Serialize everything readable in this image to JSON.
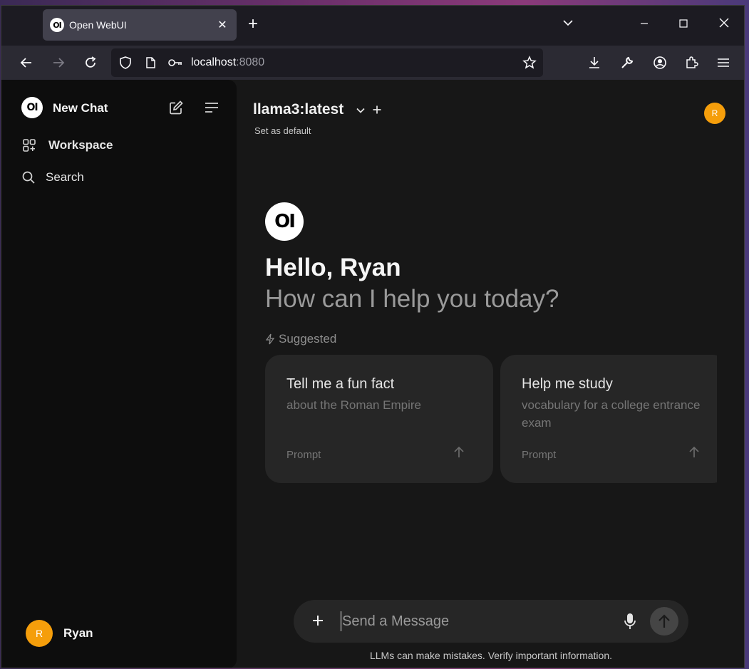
{
  "browser": {
    "tab_title": "Open WebUI",
    "tab_logo_text": "OI",
    "url_host": "localhost",
    "url_port": ":8080"
  },
  "sidebar": {
    "logo_text": "OI",
    "new_chat_label": "New Chat",
    "items": [
      {
        "label": "Workspace",
        "icon": "workspace-icon"
      },
      {
        "label": "Search",
        "icon": "search-icon"
      }
    ],
    "user": {
      "initial": "R",
      "name": "Ryan"
    }
  },
  "header": {
    "model_name": "llama3:latest",
    "set_default_label": "Set as default",
    "avatar_initial": "R"
  },
  "hero": {
    "logo_text": "OI",
    "greeting": "Hello, Ryan",
    "subtitle": "How can I help you today?",
    "suggested_label": "Suggested"
  },
  "suggestions": [
    {
      "title": "Tell me a fun fact",
      "subtitle": "about the Roman Empire",
      "prompt_label": "Prompt"
    },
    {
      "title": "Help me study",
      "subtitle": "vocabulary for a college entrance exam",
      "prompt_label": "Prompt"
    }
  ],
  "composer": {
    "placeholder": "Send a Message",
    "disclaimer": "LLMs can make mistakes. Verify important information."
  },
  "colors": {
    "avatar": "#f59e0b",
    "background": "#171717",
    "sidebar": "#0d0d0d",
    "card": "#262626"
  }
}
